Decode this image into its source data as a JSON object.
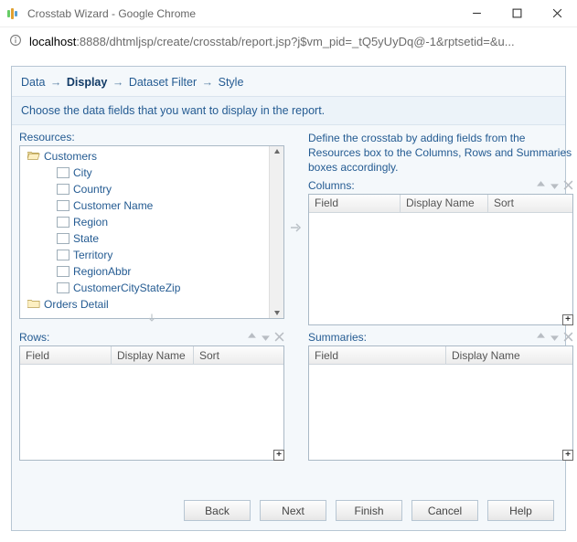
{
  "window": {
    "title": "Crosstab Wizard - Google Chrome",
    "url_host": "localhost",
    "url_rest": ":8888/dhtmljsp/create/crosstab/report.jsp?j$vm_pid=_tQ5yUyDq@-1&rptsetid=&u..."
  },
  "wizard": {
    "steps": {
      "data": "Data",
      "display": "Display",
      "filter": "Dataset Filter",
      "style": "Style"
    },
    "prompt": "Choose the data fields that you want to display in the report.",
    "resources_label": "Resources:",
    "desc": "Define the crosstab by adding fields from the Resources box to the Columns, Rows and Summaries boxes accordingly.",
    "columns_label": "Columns:",
    "rows_label": "Rows:",
    "summaries_label": "Summaries:",
    "headers": {
      "field": "Field",
      "display_name": "Display Name",
      "sort": "Sort"
    },
    "tree": {
      "group1": "Customers",
      "items": [
        "City",
        "Country",
        "Customer Name",
        "Region",
        "State",
        "Territory",
        "RegionAbbr",
        "CustomerCityStateZip"
      ],
      "group2": "Orders Detail"
    }
  },
  "buttons": {
    "back": "Back",
    "next": "Next",
    "finish": "Finish",
    "cancel": "Cancel",
    "help": "Help"
  }
}
